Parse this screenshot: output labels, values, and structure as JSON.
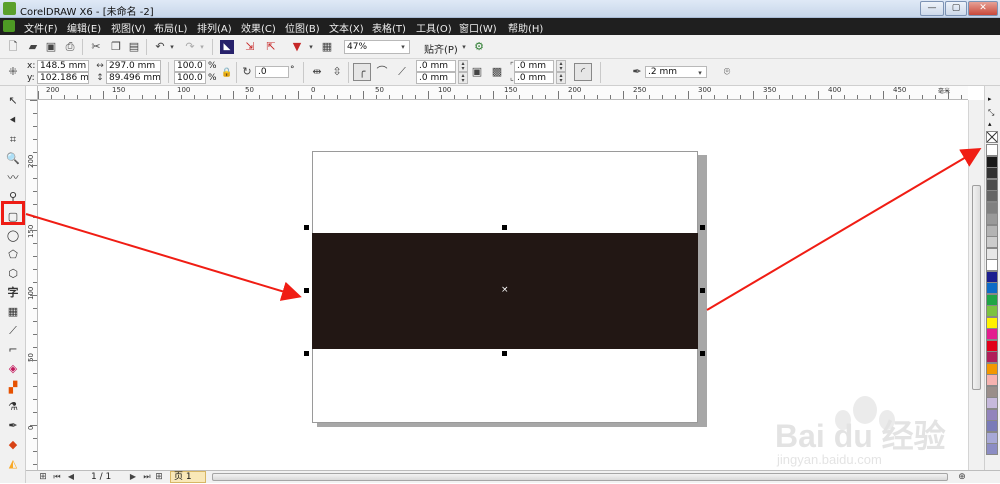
{
  "window": {
    "title": "CorelDRAW X6 - [未命名 -2]",
    "controls": [
      "—",
      "▢",
      "✕"
    ]
  },
  "menu": [
    "文件(F)",
    "编辑(E)",
    "视图(V)",
    "布局(L)",
    "排列(A)",
    "效果(C)",
    "位图(B)",
    "文本(X)",
    "表格(T)",
    "工具(O)",
    "窗口(W)",
    "帮助(H)"
  ],
  "toolbar1": {
    "zoom": "47%",
    "snap_label": "贴齐(P)"
  },
  "toolbar2": {
    "x": "148.5 mm",
    "y": "102.186 mm",
    "width": "297.0 mm",
    "height": "89.496 mm",
    "scale_x": "100.0",
    "scale_y": "100.0",
    "percent": "%",
    "x_label": "x:",
    "y_label": "y:",
    "angle": ".0",
    "angle_unit": "°",
    "corner1": ".0 mm",
    "corner2": ".0 mm",
    "corner3": ".0 mm",
    "corner4": ".0 mm",
    "outline": ".2 mm"
  },
  "ruler_top": [
    "200",
    "150",
    "100",
    "50",
    "0",
    "50",
    "100",
    "150",
    "200",
    "250",
    "300",
    "350",
    "400",
    "450"
  ],
  "ruler_left": [
    "200",
    "150",
    "100",
    "50",
    "0"
  ],
  "ruler_unit": "毫米",
  "status": {
    "page_counter": "1 / 1",
    "page_tab": "页 1"
  },
  "palette": [
    "#ffffff",
    "#1a1a1a",
    "#323232",
    "#4d4d4d",
    "#666666",
    "#808080",
    "#999999",
    "#b3b3b3",
    "#cccccc",
    "#e6e6e6",
    "#ffffff",
    "#1b1e8f",
    "#0e6cc7",
    "#1fa546",
    "#7cc241",
    "#fff200",
    "#e31d8f",
    "#e2001a",
    "#b01f5a",
    "#f39800",
    "#f6b3b0",
    "#9a8e8a",
    "#c6b9dc",
    "#9284bc",
    "#7a7bb8",
    "#a8a9d6",
    "#8c8dc4"
  ],
  "watermark": {
    "brand": "Bai du 经验",
    "url": "jingyan.baidu.com"
  }
}
